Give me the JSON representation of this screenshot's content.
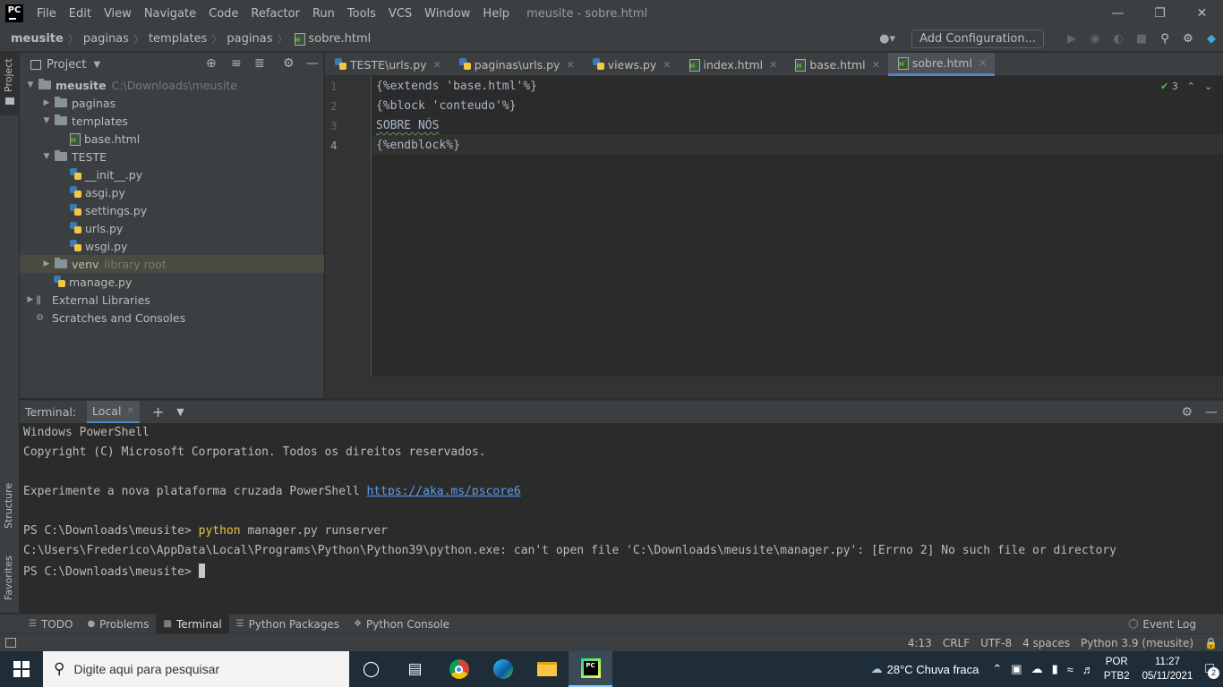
{
  "app": {
    "logo": "PC",
    "window_title": "meusite - sobre.html",
    "menu": [
      "File",
      "Edit",
      "View",
      "Navigate",
      "Code",
      "Refactor",
      "Run",
      "Tools",
      "VCS",
      "Window",
      "Help"
    ]
  },
  "breadcrumb": [
    "meusite",
    "paginas",
    "templates",
    "paginas",
    "sobre.html"
  ],
  "navbar": {
    "add_configuration": "Add Configuration..."
  },
  "left_stripe": {
    "project": "Project",
    "structure": "Structure",
    "favorites": "Favorites"
  },
  "project": {
    "title": "Project",
    "tree": [
      {
        "label": "meusite",
        "extra": "C:\\Downloads\\meusite",
        "type": "folder",
        "depth": 0,
        "arrow": "down"
      },
      {
        "label": "paginas",
        "type": "folder",
        "depth": 1,
        "arrow": "right"
      },
      {
        "label": "templates",
        "type": "folder",
        "depth": 1,
        "arrow": "down"
      },
      {
        "label": "base.html",
        "type": "html",
        "depth": 2
      },
      {
        "label": "TESTE",
        "type": "folder",
        "depth": 1,
        "arrow": "down"
      },
      {
        "label": "__init__.py",
        "type": "py",
        "depth": 2
      },
      {
        "label": "asgi.py",
        "type": "py",
        "depth": 2
      },
      {
        "label": "settings.py",
        "type": "py",
        "depth": 2
      },
      {
        "label": "urls.py",
        "type": "py",
        "depth": 2
      },
      {
        "label": "wsgi.py",
        "type": "py",
        "depth": 2
      },
      {
        "label": "venv",
        "extra": "library root",
        "type": "folder",
        "depth": 1,
        "arrow": "right",
        "selected": true
      },
      {
        "label": "manage.py",
        "type": "py",
        "depth": 1
      },
      {
        "label": "External Libraries",
        "type": "lib",
        "depth": 0,
        "arrow": "right"
      },
      {
        "label": "Scratches and Consoles",
        "type": "scratch",
        "depth": 0
      }
    ]
  },
  "editor": {
    "tabs": [
      {
        "label": "TESTE\\urls.py",
        "type": "py"
      },
      {
        "label": "paginas\\urls.py",
        "type": "py"
      },
      {
        "label": "views.py",
        "type": "py"
      },
      {
        "label": "index.html",
        "type": "html"
      },
      {
        "label": "base.html",
        "type": "html"
      },
      {
        "label": "sobre.html",
        "type": "html",
        "active": true
      }
    ],
    "line_numbers": [
      "1",
      "2",
      "3",
      "4"
    ],
    "lines": [
      "{%extends 'base.html'%}",
      "{%block 'conteudo'%}",
      "SOBRE NÓS",
      "{%endblock%}"
    ],
    "inspection_count": "3"
  },
  "terminal": {
    "label": "Terminal:",
    "tab": "Local",
    "lines": [
      "Windows PowerShell",
      "Copyright (C) Microsoft Corporation. Todos os direitos reservados.",
      "",
      "Experimente a nova plataforma cruzada PowerShell ",
      "",
      "PS C:\\Downloads\\meusite> ",
      "C:\\Users\\Frederico\\AppData\\Local\\Programs\\Python\\Python39\\python.exe: can't open file 'C:\\Downloads\\meusite\\manager.py': [Errno 2] No such file or directory",
      "PS C:\\Downloads\\meusite> "
    ],
    "link": "https://aka.ms/pscore6",
    "command": "python",
    "command_args": " manager.py runserver"
  },
  "tool_windows": [
    "TODO",
    "Problems",
    "Terminal",
    "Python Packages",
    "Python Console"
  ],
  "event_log": "Event Log",
  "status": [
    "4:13",
    "CRLF",
    "UTF-8",
    "4 spaces",
    "Python 3.9 (meusite)"
  ],
  "taskbar": {
    "search_placeholder": "Digite aqui para pesquisar",
    "weather": "28°C  Chuva fraca",
    "lang1": "POR",
    "lang2": "PTB2",
    "time": "11:27",
    "date": "05/11/2021",
    "notifications": "2"
  },
  "colors": {
    "accent": "#4a88c7",
    "bg": "#2b2b2b",
    "panel": "#3c3f41"
  }
}
